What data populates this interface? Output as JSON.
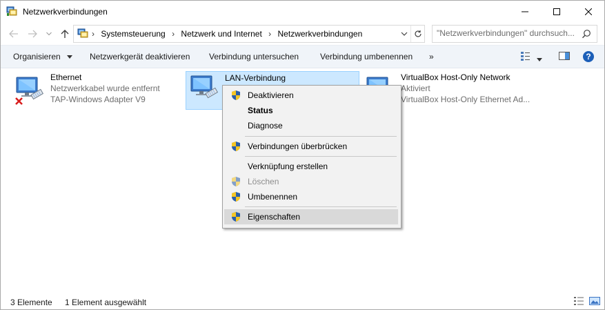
{
  "window": {
    "title": "Netzwerkverbindungen"
  },
  "address": {
    "crumbs": [
      "Systemsteuerung",
      "Netzwerk und Internet",
      "Netzwerkverbindungen"
    ]
  },
  "search": {
    "placeholder": "\"Netzwerkverbindungen\" durchsuch..."
  },
  "commandbar": {
    "organize": "Organisieren",
    "disable": "Netzwerkgerät deaktivieren",
    "diagnose": "Verbindung untersuchen",
    "rename": "Verbindung umbenennen",
    "more": "»"
  },
  "items": [
    {
      "name": "Ethernet",
      "status": "Netzwerkkabel wurde entfernt",
      "adapter": "TAP-Windows Adapter V9"
    },
    {
      "name": "LAN-Verbindung",
      "status": "",
      "adapter": ""
    },
    {
      "name": "VirtualBox Host-Only Network",
      "status": "Aktiviert",
      "adapter": "VirtualBox Host-Only Ethernet Ad..."
    }
  ],
  "context_menu": {
    "items": [
      {
        "label": "Deaktivieren",
        "shield": true
      },
      {
        "label": "Status",
        "bold": true
      },
      {
        "label": "Diagnose"
      },
      {
        "label": "Verbindungen überbrücken",
        "shield": true
      },
      {
        "label": "Verknüpfung erstellen"
      },
      {
        "label": "Löschen",
        "shield": true,
        "disabled": true
      },
      {
        "label": "Umbenennen",
        "shield": true
      },
      {
        "label": "Eigenschaften",
        "shield": true,
        "highlighted": true
      }
    ]
  },
  "statusbar": {
    "count": "3 Elemente",
    "selected": "1 Element ausgewählt"
  },
  "colors": {
    "accent": "#0078d7",
    "selection_bg": "#cce8ff",
    "selection_border": "#99d1ff",
    "help": "#1c5fb8"
  }
}
